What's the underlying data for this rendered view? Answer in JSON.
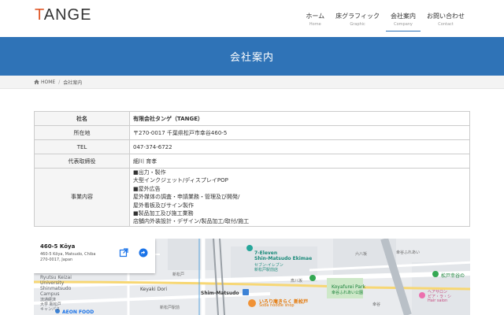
{
  "header": {
    "logo_first": "T",
    "logo_rest": "ANGE",
    "nav": [
      {
        "jp": "ホーム",
        "en": "Home"
      },
      {
        "jp": "床グラフィック",
        "en": "Graphic"
      },
      {
        "jp": "会社案内",
        "en": "Company"
      },
      {
        "jp": "お問い合わせ",
        "en": "Contact"
      }
    ],
    "active_index": 2
  },
  "banner": {
    "title": "会社案内"
  },
  "breadcrumb": {
    "home": "HOME",
    "current": "会社案内"
  },
  "company": {
    "name_label": "社名",
    "name_value": "有限会社タンゲ（TANGE）",
    "address_label": "所在地",
    "address_value": "〒270-0017 千葉県松戸市幸谷460-5",
    "tel_label": "TEL",
    "tel_value": "047-374-6722",
    "ceo_label": "代表取締役",
    "ceo_value": "細川 育孝",
    "business_label": "事業内容",
    "business_lines": [
      "■出力・製作",
      "大型インクジェット/ディスプレイPOP",
      "■屋外広告",
      "屋外媒体の調査・申請業務・管理及び開発/",
      "屋外看板及びサイン製作",
      "■製品加工及び施工業務",
      "店舗内外装設計・デザイン/製品加工/取付/施工"
    ]
  },
  "map": {
    "card_title": "460-5 Kōya",
    "card_addr_1": "460-5 Kōya, Matsudo, Chiba",
    "card_addr_2": "270-0017, Japan",
    "labels": {
      "eleven": "7-Eleven",
      "eleven_sub": "Shin-Matsudo Ekimae",
      "eleven_jp1": "セブン-イレブン",
      "eleven_jp2": "新松戸駅前店",
      "ryutsu1": "Ryutsu Keizai",
      "ryutsu2": "University",
      "ryutsu3": "Shinmatsudo",
      "ryutsu4": "Campus",
      "ryutsu_jp1": "流通経済",
      "ryutsu_jp2": "大学 新松戸",
      "ryutsu_jp3": "キャンパス",
      "keyaki": "Keyaki Dori",
      "shim": "Shim-Matsudo",
      "iroriya1": "いろり庵きらく 新松戸",
      "iroriya2": "Soba noodle shop",
      "koyafurei1": "Koyafurei Park",
      "koyafurei2": "幸谷ふれあい公園",
      "matsudo_koya": "松戸幸谷の",
      "hair1": "ヘアサロン",
      "hair2": "ピア・ラ・シ",
      "hair3": "Hair salon",
      "aeon": "AEON FOOD",
      "machi1": "幸谷ふれあい",
      "rokugo": "六八坂",
      "sai": "斎八坂",
      "r4": "新松戸",
      "r5": "幸谷",
      "r6": "新松戸駅前"
    }
  }
}
